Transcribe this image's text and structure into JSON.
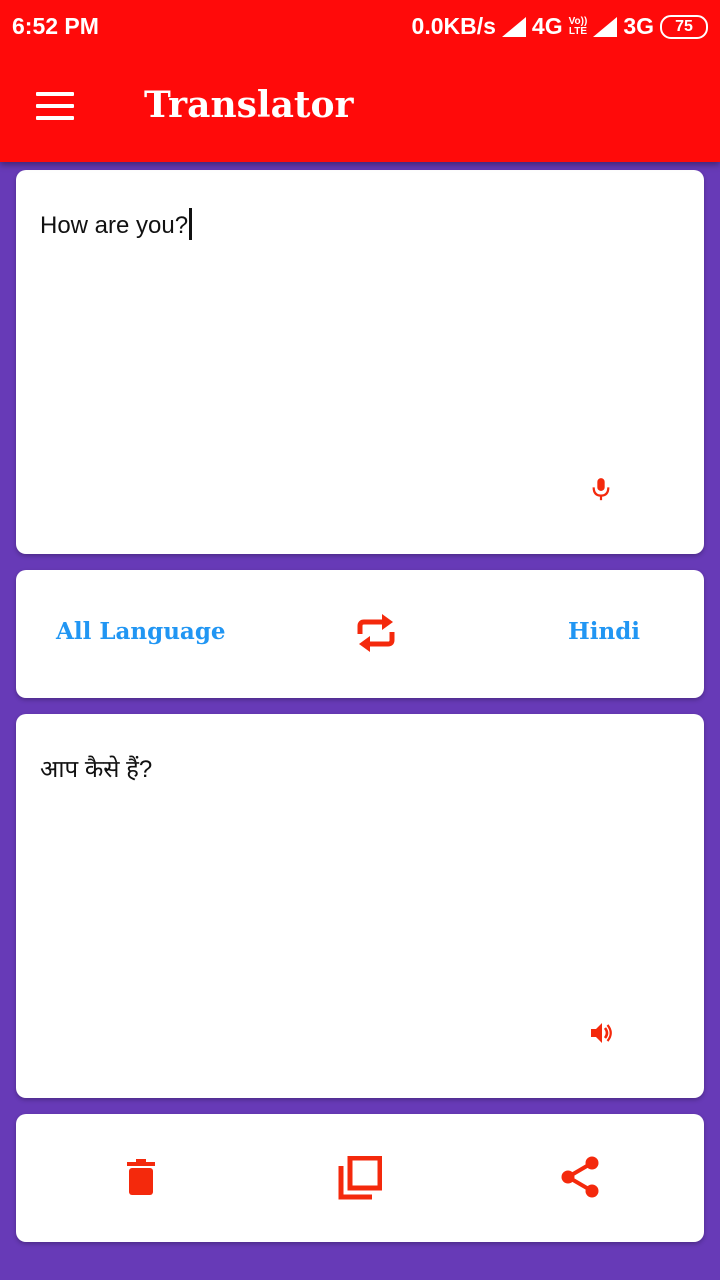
{
  "status_bar": {
    "time": "6:52 PM",
    "network_speed": "0.0KB/s",
    "network_1": "4G",
    "volte_top": "Vo))",
    "volte_bottom": "LTE",
    "network_2": "3G",
    "battery": "75"
  },
  "app_bar": {
    "title": "Translator",
    "menu_icon": "hamburger-menu-icon",
    "color": "#ff0a0a"
  },
  "input_card": {
    "text": "How are you?",
    "mic_icon": "microphone-icon"
  },
  "language_bar": {
    "source_language": "All Language",
    "target_language": "Hindi",
    "swap_icon": "swap-repeat-icon",
    "label_color": "#2196f3"
  },
  "output_card": {
    "text": "आप कैसे हैं?",
    "speaker_icon": "speaker-volume-icon"
  },
  "actions": {
    "delete_icon": "trash-icon",
    "copy_icon": "copy-icon",
    "share_icon": "share-icon"
  },
  "colors": {
    "background": "#673ab7",
    "accent_icon": "#f4290c"
  }
}
